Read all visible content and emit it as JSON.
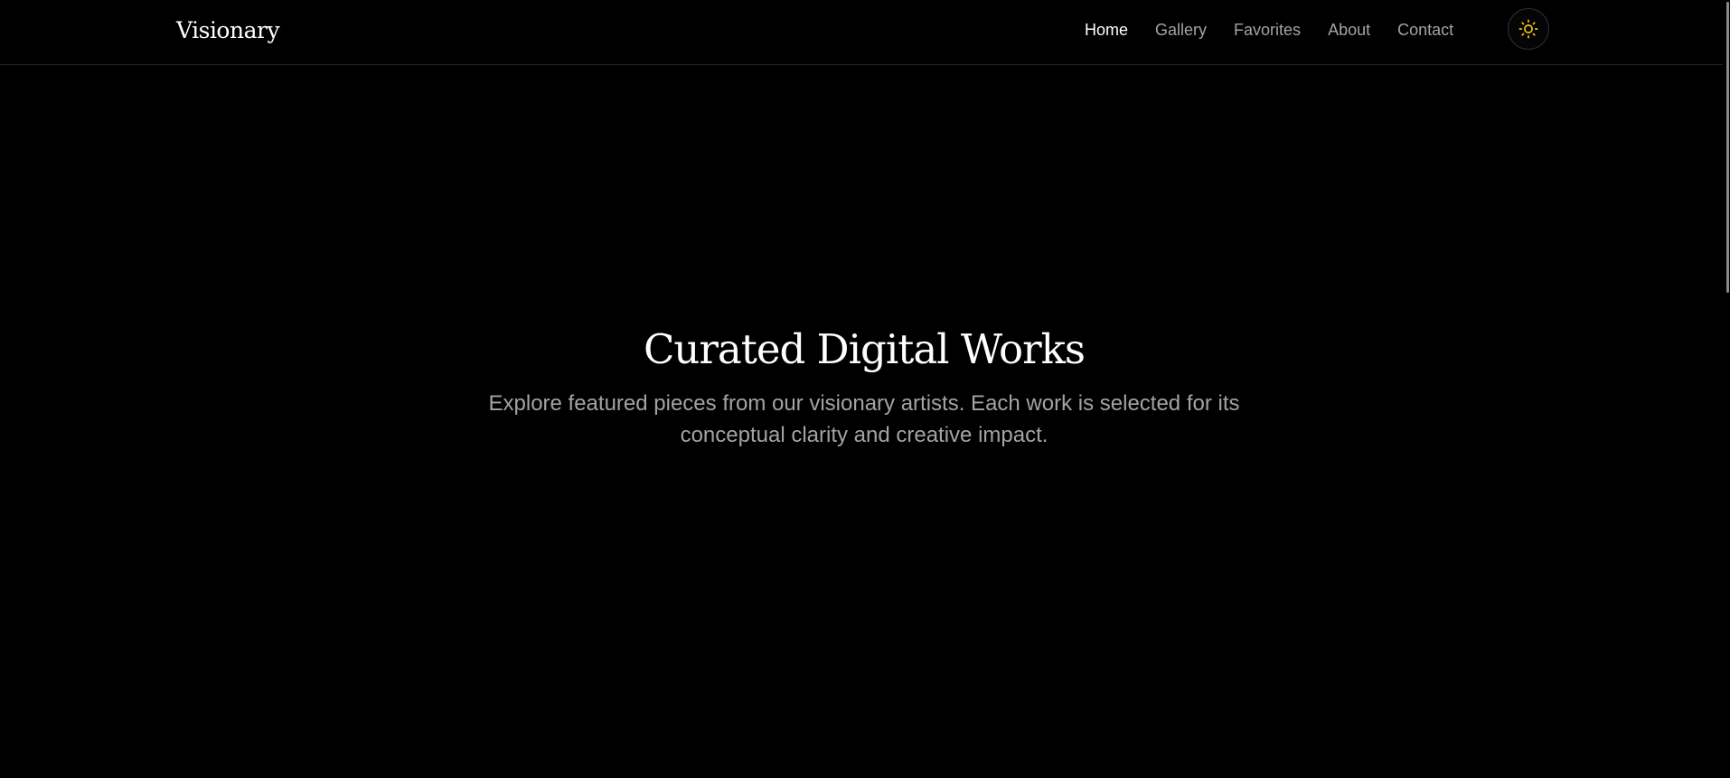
{
  "header": {
    "logo": "Visionary",
    "nav": [
      {
        "label": "Home",
        "active": true
      },
      {
        "label": "Gallery",
        "active": false
      },
      {
        "label": "Favorites",
        "active": false
      },
      {
        "label": "About",
        "active": false
      },
      {
        "label": "Contact",
        "active": false
      }
    ],
    "theme_toggle_icon": "sun-icon"
  },
  "hero": {
    "title": "Curated Digital Works",
    "subtitle": "Explore featured pieces from our visionary artists. Each work is selected for its conceptual clarity and creative impact."
  },
  "colors": {
    "background": "#000000",
    "text_primary": "#ffffff",
    "text_muted": "#a3a3a3",
    "accent_sun": "#f5c518"
  }
}
